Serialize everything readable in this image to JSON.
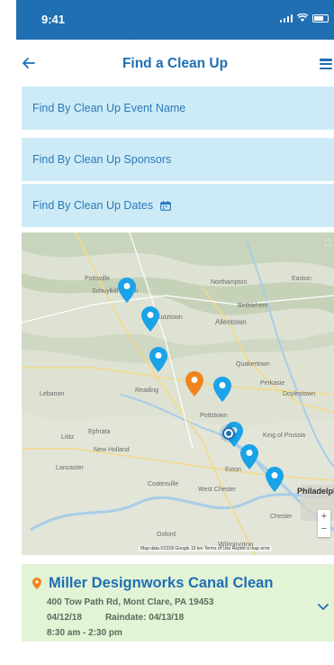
{
  "status": {
    "time": "9:41"
  },
  "header": {
    "title": "Find a Clean Up"
  },
  "filters": [
    {
      "label": "Find By Clean Up Event Name"
    },
    {
      "label": "Find By Clean Up Sponsors"
    },
    {
      "label": "Find By Clean Up Dates"
    }
  ],
  "map": {
    "labels": [
      "Pottsville",
      "Schuylkill Haven",
      "Kutztown",
      "Allentown",
      "Northampton",
      "Easton",
      "Bethlehem",
      "Quakertown",
      "Reading",
      "Lebanon",
      "Perkasie",
      "Doylestown",
      "Ephrata",
      "Lititz",
      "Lancaster",
      "Pottstown",
      "King of Prussia",
      "Exton",
      "West Chester",
      "Philadelphia",
      "Chester",
      "Wilmington",
      "Oxford",
      "New Holland",
      "Coatesville"
    ],
    "attribution": "Map data ©2018 Google   10 km        Terms of Use   Report a map error",
    "pins": [
      {
        "type": "event",
        "color": "#1aa3e8"
      },
      {
        "type": "event",
        "color": "#1aa3e8"
      },
      {
        "type": "event",
        "color": "#1aa3e8"
      },
      {
        "type": "selected",
        "color": "#f0841d"
      },
      {
        "type": "event",
        "color": "#1aa3e8"
      },
      {
        "type": "event",
        "color": "#1aa3e8"
      },
      {
        "type": "event",
        "color": "#1aa3e8"
      },
      {
        "type": "event",
        "color": "#1aa3e8"
      }
    ]
  },
  "result": {
    "title": "Miller Designworks Canal Clean",
    "address": "400 Tow Path Rd, Mont Clare, PA 19453",
    "date": "04/12/18",
    "raindate": "Raindate: 04/13/18",
    "time": "8:30 am - 2:30 pm"
  },
  "colors": {
    "primary": "#1f6fb2",
    "filter_bg": "#cdebf7",
    "result_bg": "#e3f3d6",
    "pin": "#1aa3e8",
    "pin_selected": "#f0841d"
  }
}
